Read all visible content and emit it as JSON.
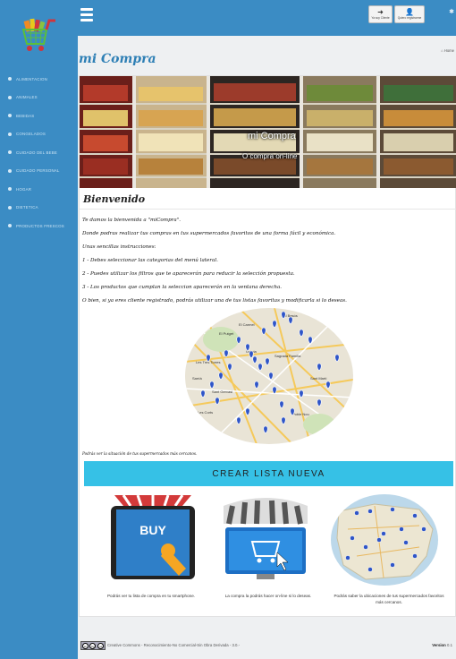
{
  "sidebar": {
    "items": [
      {
        "label": "ALIMENTACION"
      },
      {
        "label": "ANIMALES"
      },
      {
        "label": "BEBIDAS"
      },
      {
        "label": "CONGELADOS"
      },
      {
        "label": "CUIDADO DEL BEBE"
      },
      {
        "label": "CUIDADO PERSONAL"
      },
      {
        "label": "HOGAR"
      },
      {
        "label": "DIETETICA"
      },
      {
        "label": "PRODUCTOS FRESCOS"
      }
    ]
  },
  "topbar": {
    "client_label": "Ya soy Cliente",
    "register_label": "Quiero registrarme"
  },
  "header": {
    "title": "mi Compra",
    "breadcrumb": "Home"
  },
  "banner": {
    "caption_main": "mi Compra",
    "caption_sub": "O compra on-line"
  },
  "welcome": {
    "heading": "Bienvenido",
    "lines": [
      "Te damos la bienvenida a \"miCompra\".",
      "Donde podras realizar tus compras en tus supermercados favoritos de una forma fácil y económica.",
      "Unas sencillas instrucciones:",
      "1 - Debes seleccionar las categorias del menú lateral.",
      "2 - Puedes utilizar los filtros que te aparecerán para reducir la selección propuesta.",
      "3 - Los productos que cumplan la seleccion aparecerán en la ventana derecha.",
      "O bien, si ya eres cliente registrado, podrás utilizar una de tus listas favoritas y modificarla si lo deseas."
    ]
  },
  "map": {
    "caption": "Podrás ver la situación de tus supermercados más cercanos.",
    "labels": [
      "El Besós",
      "El Carmel",
      "Sagrada Família",
      "Les Tres Torres",
      "Sant Gervasi",
      "Gràcia",
      "Sarrià",
      "El Putget",
      "Les Corts",
      "Sant Martí",
      "Poble Nou"
    ]
  },
  "crear_button": "CREAR LISTA NUEVA",
  "features": [
    {
      "caption": "Podrás ver tu lista de compra en tu smartphone.",
      "icon": "buy-tablet-icon",
      "badge": "BUY"
    },
    {
      "caption": "La compra la podrás hacer on-line si lo deseas.",
      "icon": "online-shop-icon"
    },
    {
      "caption_line1": "Podrás saber la ubicaciones de tus supermercados favoritos",
      "caption_line2": "más cercanos.",
      "icon": "spain-map-icon"
    }
  ],
  "footer": {
    "license": "Creative Commons - Reconocimiento-No Comercial-Sin Obra Derivada - 3.0.-",
    "version_label": "Version",
    "version_value": "0.1",
    "cc_badge": "cc by nc nd"
  },
  "colors": {
    "sidebar": "#3b8cc4",
    "accent_button": "#36c1e6",
    "title": "#2e7fb5"
  }
}
